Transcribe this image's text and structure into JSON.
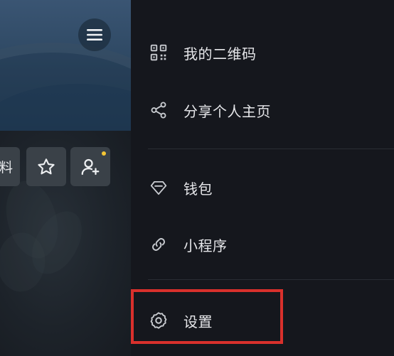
{
  "profile": {
    "menu_icon": "hamburger-menu-icon",
    "edit_partial_label": "料",
    "favorite_icon": "star-icon",
    "add_friend_icon": "add-user-icon",
    "notification_dot_color": "#f4c534"
  },
  "drawer": {
    "items": [
      {
        "label": "我的二维码",
        "icon": "qr-code-icon"
      },
      {
        "label": "分享个人主页",
        "icon": "share-icon"
      },
      {
        "label": "钱包",
        "icon": "diamond-wallet-icon"
      },
      {
        "label": "小程序",
        "icon": "mini-program-link-icon"
      },
      {
        "label": "设置",
        "icon": "gear-icon"
      }
    ],
    "highlight_color": "#d9302c"
  }
}
